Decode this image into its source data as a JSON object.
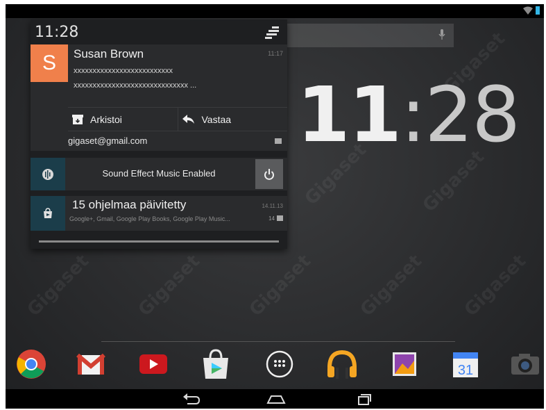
{
  "shade": {
    "time": "11:28",
    "gmail": {
      "avatar_letter": "S",
      "sender": "Susan Brown",
      "time": "11:17",
      "line1": "xxxxxxxxxxxxxxxxxxxxxxxxxx",
      "line2": "xxxxxxxxxxxxxxxxxxxxxxxxxxxxxx ...",
      "archive_label": "Arkistoi",
      "reply_label": "Vastaa",
      "account": "gigaset@gmail.com"
    },
    "sound": {
      "label": "Sound Effect Music Enabled"
    },
    "update": {
      "title": "15 ohjelmaa päivitetty",
      "subtitle": "Google+, Gmail, Google Play Books, Google Play Music...",
      "date": "14.11.13",
      "count": "14"
    }
  },
  "home": {
    "clock_hour": "11",
    "clock_sep": ":",
    "clock_min": "28"
  },
  "watermark": "Gigaset",
  "dock": {
    "apps": [
      "chrome-icon",
      "gmail-icon",
      "youtube-icon",
      "play-store-icon",
      "app-drawer-icon",
      "play-music-icon",
      "gallery-icon",
      "calendar-icon",
      "camera-icon"
    ],
    "calendar_day": "31"
  },
  "colors": {
    "avatar": "#f0804b",
    "accent_box": "#1b3d4a",
    "status_accent": "#33b5e5"
  }
}
